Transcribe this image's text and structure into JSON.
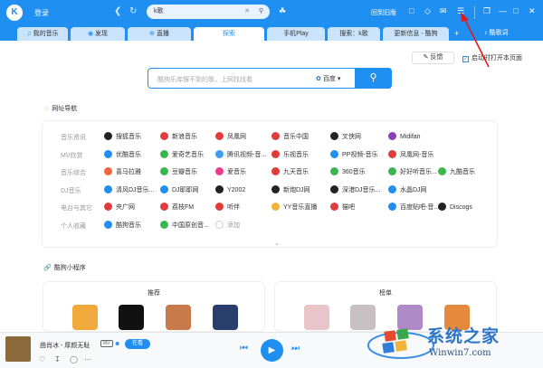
{
  "titlebar": {
    "logo_letter": "K",
    "login": "登录",
    "search_value": "k歌",
    "old_version": "回到旧版",
    "colors": {
      "brand": "#1f8ff2"
    }
  },
  "tabs": [
    {
      "label": "我的音乐",
      "icon": "music-note-icon"
    },
    {
      "label": "发现",
      "icon": "compass-icon"
    },
    {
      "label": "直播",
      "icon": "plus-icon"
    },
    {
      "label": "探索",
      "active": true
    },
    {
      "label": "手机Play"
    },
    {
      "label": "搜索：k歌"
    },
    {
      "label": "更新信息 - 酷狗"
    }
  ],
  "tab_right": "酷歌词",
  "toolbar": {
    "feedback": "反馈",
    "auto_open": "启动时打开本页面"
  },
  "search": {
    "placeholder": "酷狗乐库搜不到的歌，上网找找看",
    "engine": "百度"
  },
  "nav_title": "网址导航",
  "nav_rows": [
    {
      "category": "音乐资讯",
      "sites": [
        {
          "name": "搜狐音乐",
          "color": "#222222"
        },
        {
          "name": "新浪音乐",
          "color": "#e03c3c"
        },
        {
          "name": "凤凰网",
          "color": "#e03c3c"
        },
        {
          "name": "音乐中国",
          "color": "#e03c3c"
        },
        {
          "name": "叉侠网",
          "color": "#222222"
        },
        {
          "name": "Midifan",
          "color": "#8a3fb8"
        }
      ]
    },
    {
      "category": "MV欣赏",
      "sites": [
        {
          "name": "优酷音乐",
          "color": "#1f8ff2"
        },
        {
          "name": "爱奇艺音乐",
          "color": "#38b84a"
        },
        {
          "name": "腾讯视频-音...",
          "color": "#3c9ff0"
        },
        {
          "name": "乐视音乐",
          "color": "#e03c3c"
        },
        {
          "name": "PP视频-音乐",
          "color": "#1f8ff2"
        },
        {
          "name": "凤凰网-音乐",
          "color": "#e03c3c"
        }
      ]
    },
    {
      "category": "音乐综合",
      "sites": [
        {
          "name": "喜马拉雅",
          "color": "#f2653c"
        },
        {
          "name": "豆瓣音乐",
          "color": "#38b84a"
        },
        {
          "name": "爱音乐",
          "color": "#e93c8c"
        },
        {
          "name": "九天音乐",
          "color": "#e03c3c"
        },
        {
          "name": "360音乐",
          "color": "#38b84a"
        },
        {
          "name": "好好听音乐...",
          "color": "#38b84a"
        },
        {
          "name": "九酷音乐",
          "color": "#38b84a"
        }
      ]
    },
    {
      "category": "DJ音乐",
      "sites": [
        {
          "name": "清风DJ音乐...",
          "color": "#1f8ff2"
        },
        {
          "name": "DJ耶耶网",
          "color": "#1f8ff2"
        },
        {
          "name": "Y2002",
          "color": "#222222"
        },
        {
          "name": "新炮DJ网",
          "color": "#222222"
        },
        {
          "name": "深港DJ音乐...",
          "color": "#222222"
        },
        {
          "name": "水晶DJ网",
          "color": "#1f8ff2"
        }
      ]
    },
    {
      "category": "电台与其它",
      "sites": [
        {
          "name": "央广网",
          "color": "#e03c3c"
        },
        {
          "name": "荔枝FM",
          "color": "#e03c3c"
        },
        {
          "name": "听伴",
          "color": "#e03c3c"
        },
        {
          "name": "YY音乐直播",
          "color": "#f2b33c"
        },
        {
          "name": "猫吧",
          "color": "#e03c3c"
        },
        {
          "name": "百度贴吧-音...",
          "color": "#1f8ff2"
        },
        {
          "name": "Discogs",
          "color": "#222222"
        }
      ]
    },
    {
      "category": "个人收藏",
      "sites": [
        {
          "name": "酷狗音乐",
          "color": "#1f8ff2"
        },
        {
          "name": "中国原创音...",
          "color": "#38b84a"
        },
        {
          "name": "添加",
          "color": "#bbbbbb",
          "add": true
        }
      ]
    }
  ],
  "mini_title": "酷狗小程序",
  "cards": [
    {
      "title": "推荐",
      "thumbs": [
        "#f2a93c",
        "#111111",
        "#c97a4a",
        "#2a3e6e"
      ]
    },
    {
      "title": "榜单",
      "thumbs": [
        "#e9c4c8",
        "#c9c0c4",
        "#b08ac8",
        "#e58a3c"
      ]
    }
  ],
  "player": {
    "song": "曲肖冰 - 厚颜无耻",
    "mv": "MV",
    "listening": "在看"
  },
  "watermark": {
    "text": "系统之家",
    "url": "Winwin7.com"
  }
}
